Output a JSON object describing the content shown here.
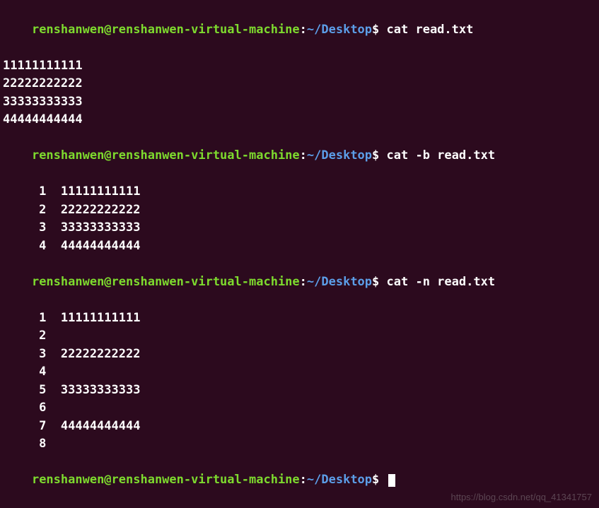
{
  "prompt": {
    "user": "renshanwen@renshanwen-virtual-machine",
    "colon": ":",
    "path": "~/Desktop",
    "dollar": "$"
  },
  "commands": {
    "cmd1": "cat read.txt",
    "cmd2": "cat -b read.txt",
    "cmd3": "cat -n read.txt"
  },
  "output1": {
    "l1": "11111111111",
    "l2": "",
    "l3": "22222222222",
    "l4": "",
    "l5": "33333333333",
    "l6": "",
    "l7": "44444444444",
    "l8": ""
  },
  "output2": {
    "l1": "     1  11111111111",
    "l2": "",
    "l3": "     2  22222222222",
    "l4": "",
    "l5": "     3  33333333333",
    "l6": "",
    "l7": "     4  44444444444",
    "l8": ""
  },
  "output3": {
    "l1": "     1  11111111111",
    "l2": "     2",
    "l3": "     3  22222222222",
    "l4": "     4",
    "l5": "     5  33333333333",
    "l6": "     6",
    "l7": "     7  44444444444",
    "l8": "     8"
  },
  "watermark": "https://blog.csdn.net/qq_41341757"
}
